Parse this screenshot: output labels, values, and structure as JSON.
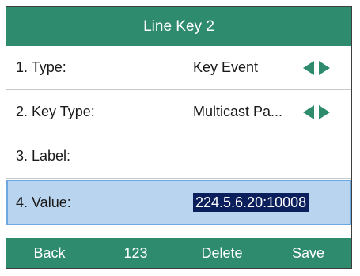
{
  "title": "Line Key 2",
  "rows": [
    {
      "label": "1. Type:",
      "value": "Key Event",
      "has_arrows": true
    },
    {
      "label": "2. Key Type:",
      "value": "Multicast Pa...",
      "has_arrows": true
    },
    {
      "label": "3. Label:",
      "value": "",
      "has_arrows": false
    },
    {
      "label": "4. Value:",
      "value": "224.5.6.20:10008",
      "has_arrows": false,
      "selected": true
    }
  ],
  "softkeys": [
    "Back",
    "123",
    "Delete",
    "Save"
  ],
  "icons": {
    "left": "left-triangle-arrow-icon",
    "right": "right-triangle-arrow-icon"
  },
  "colors": {
    "bar": "#2e8b6e",
    "arrow": "#2e8b6e",
    "selected_row": "#b9d4ee",
    "selected_border": "#6ea8e0",
    "value_highlight": "#0b1f5c"
  }
}
